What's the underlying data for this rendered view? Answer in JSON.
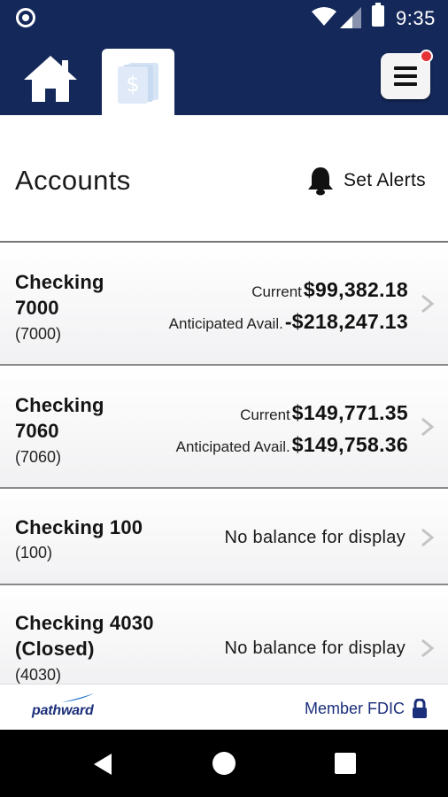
{
  "status_bar": {
    "time": "9:35"
  },
  "nav": {
    "home_icon": "home-icon",
    "accounts_icon": "money-icon",
    "menu_icon": "hamburger-menu-icon",
    "menu_badge_color": "#e53238"
  },
  "header": {
    "title": "Accounts",
    "alerts_label": "Set Alerts",
    "alerts_icon": "bell-icon"
  },
  "accounts": [
    {
      "name_line1": "Checking",
      "name_line2": "7000",
      "number": "(7000)",
      "current_label": "Current",
      "current_value": "$99,382.18",
      "anticipated_label": "Anticipated Avail.",
      "anticipated_value": "-$218,247.13"
    },
    {
      "name_line1": "Checking",
      "name_line2": "7060",
      "number": "(7060)",
      "current_label": "Current",
      "current_value": "$149,771.35",
      "anticipated_label": "Anticipated Avail.",
      "anticipated_value": "$149,758.36"
    },
    {
      "name_line1": "Checking 100",
      "number": "(100)",
      "no_balance": "No balance for display"
    },
    {
      "name_line1": "Checking 4030",
      "name_line2": "(Closed)",
      "number": "(4030)",
      "no_balance": "No balance for display"
    }
  ],
  "footer": {
    "logo_text": "pathward",
    "fdic_label": "Member FDIC",
    "lock_icon": "lock-icon"
  },
  "colors": {
    "brand_navy": "#14285a",
    "link_blue": "#1b2f7a"
  }
}
